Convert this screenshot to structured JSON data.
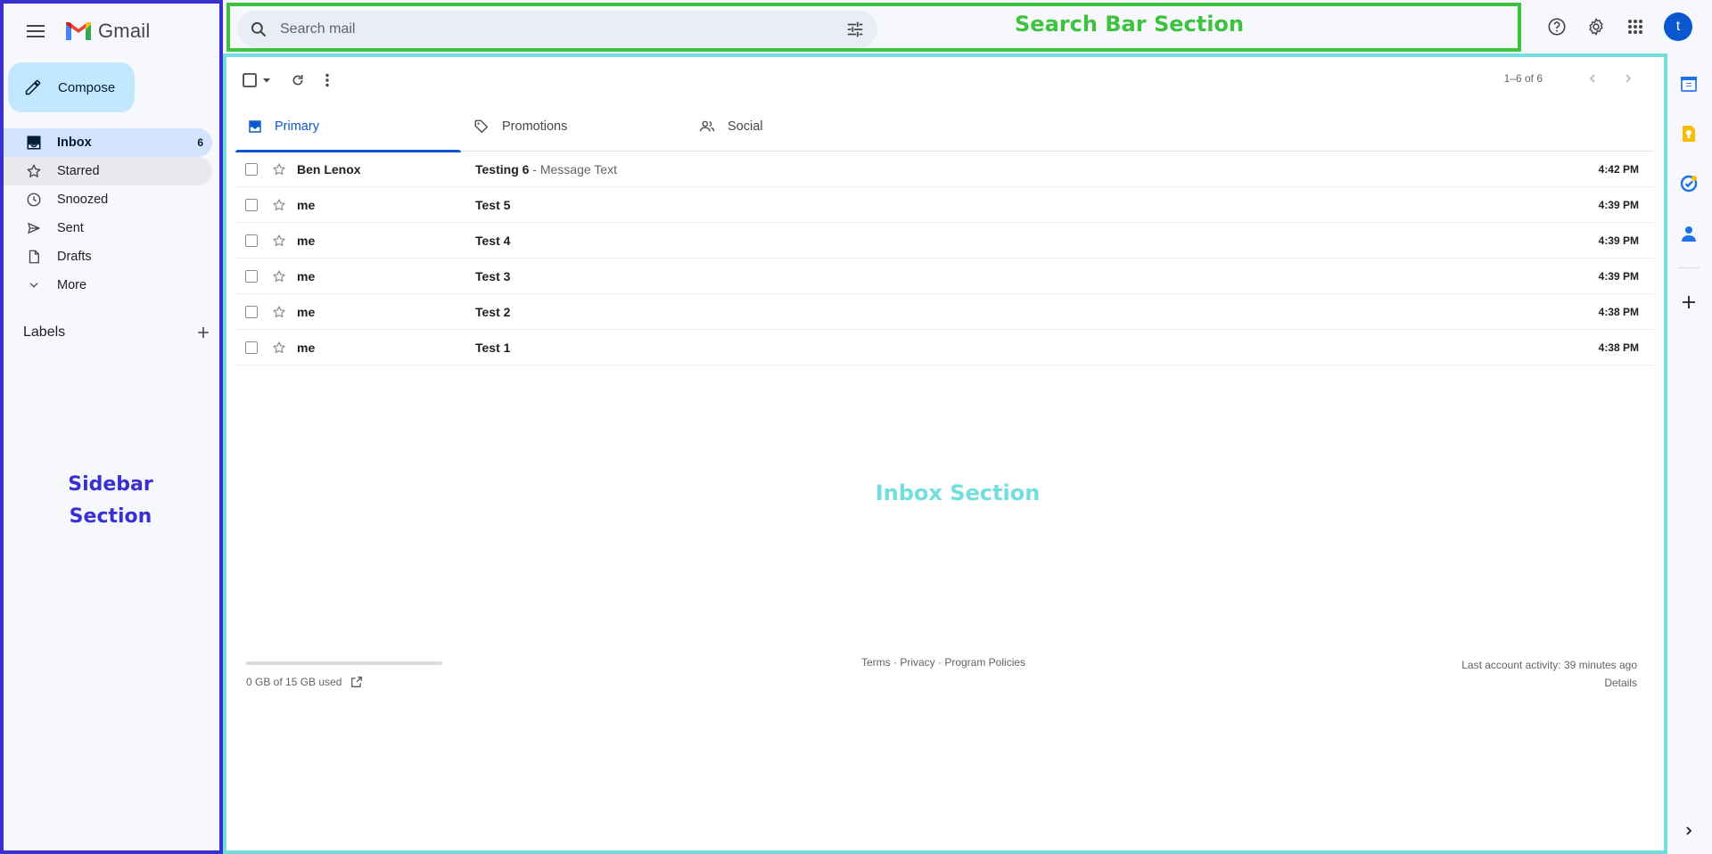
{
  "app": {
    "name": "Gmail"
  },
  "sidebar": {
    "compose_label": "Compose",
    "items": [
      {
        "label": "Inbox",
        "count": "6",
        "icon": "inbox-icon"
      },
      {
        "label": "Starred",
        "icon": "star-icon"
      },
      {
        "label": "Snoozed",
        "icon": "clock-icon"
      },
      {
        "label": "Sent",
        "icon": "send-icon"
      },
      {
        "label": "Drafts",
        "icon": "draft-icon"
      },
      {
        "label": "More",
        "icon": "chevron-down-icon"
      }
    ],
    "labels_title": "Labels",
    "section_tag_line1": "Sidebar",
    "section_tag_line2": "Section"
  },
  "search": {
    "placeholder": "Search mail",
    "section_tag": "Search Bar Section"
  },
  "account": {
    "avatar_letter": "t"
  },
  "toolbar": {
    "pager_text": "1–6 of 6"
  },
  "tabs": [
    {
      "label": "Primary",
      "active": true
    },
    {
      "label": "Promotions",
      "active": false
    },
    {
      "label": "Social",
      "active": false
    }
  ],
  "emails": [
    {
      "sender": "Ben Lenox",
      "subject": "Testing 6",
      "snippet": " - Message Text",
      "time": "4:42 PM"
    },
    {
      "sender": "me",
      "subject": "Test 5",
      "snippet": "",
      "time": "4:39 PM"
    },
    {
      "sender": "me",
      "subject": "Test 4",
      "snippet": "",
      "time": "4:39 PM"
    },
    {
      "sender": "me",
      "subject": "Test 3",
      "snippet": "",
      "time": "4:39 PM"
    },
    {
      "sender": "me",
      "subject": "Test 2",
      "snippet": "",
      "time": "4:38 PM"
    },
    {
      "sender": "me",
      "subject": "Test 1",
      "snippet": "",
      "time": "4:38 PM"
    }
  ],
  "inbox": {
    "section_tag": "Inbox Section"
  },
  "footer": {
    "storage_text": "0 GB of 15 GB used",
    "storage_used_fraction": 0.0,
    "links": "Terms · Privacy · Program Policies",
    "activity": "Last account activity: 39 minutes ago",
    "details": "Details"
  },
  "colors": {
    "sidebar_outline": "#3a2fd1",
    "searchbar_outline": "#3fc23f",
    "inbox_outline": "#72dedd",
    "accent": "#0b57d0",
    "compose_bg": "#c2e7ff"
  }
}
